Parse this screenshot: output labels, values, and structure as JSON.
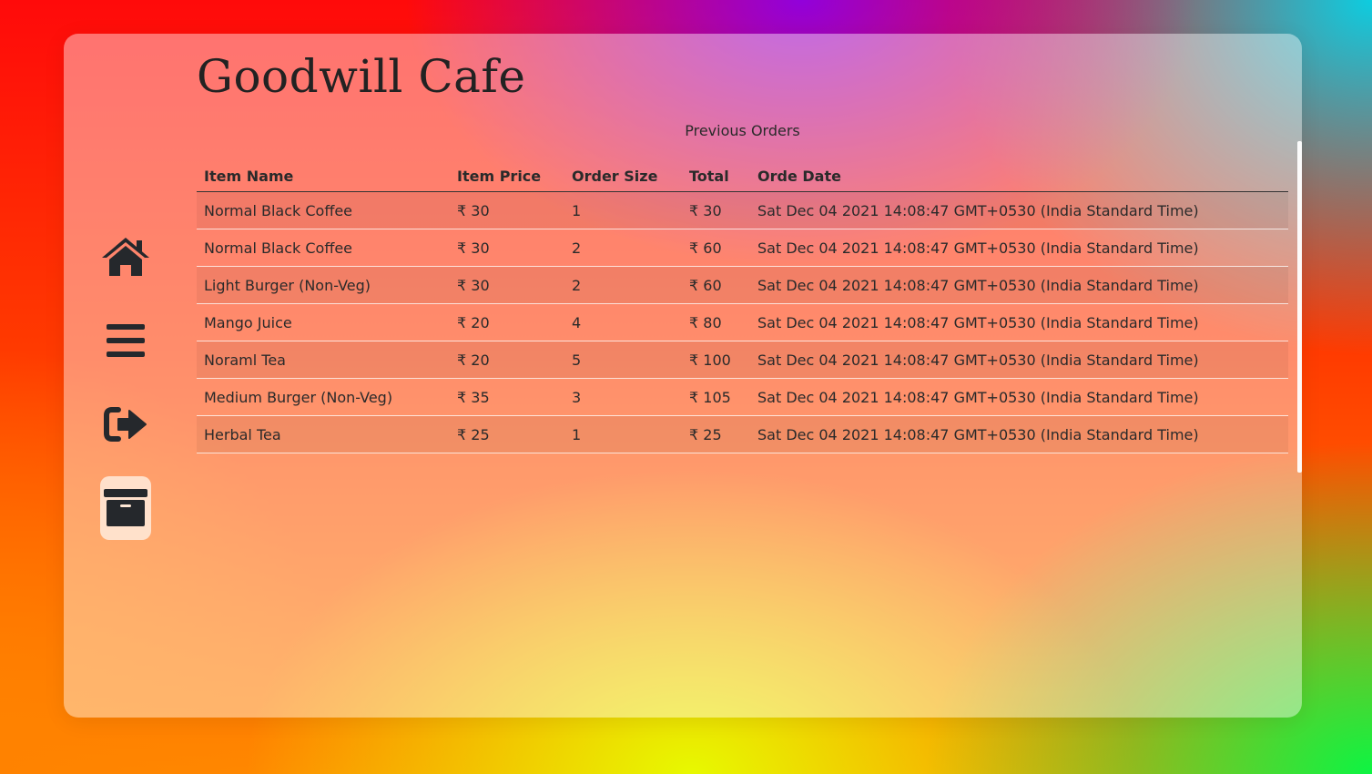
{
  "app": {
    "title": "Goodwill Cafe"
  },
  "sidebar": {
    "items": [
      {
        "name": "home",
        "icon": "home-icon",
        "active": false
      },
      {
        "name": "menu",
        "icon": "hamburger-menu-icon",
        "active": false
      },
      {
        "name": "logout",
        "icon": "sign-out-icon",
        "active": false
      },
      {
        "name": "orders",
        "icon": "archive-box-icon",
        "active": true
      }
    ]
  },
  "orders": {
    "caption": "Previous Orders",
    "headers": [
      "Item Name",
      "Item Price",
      "Order Size",
      "Total",
      "Orde Date"
    ],
    "rows": [
      [
        "Normal Black Coffee",
        "₹ 30",
        "1",
        "₹ 30",
        "Sat Dec 04 2021 14:08:47 GMT+0530 (India Standard Time)"
      ],
      [
        "Normal Black Coffee",
        "₹ 30",
        "2",
        "₹ 60",
        "Sat Dec 04 2021 14:08:47 GMT+0530 (India Standard Time)"
      ],
      [
        "Light Burger (Non-Veg)",
        "₹ 30",
        "2",
        "₹ 60",
        "Sat Dec 04 2021 14:08:47 GMT+0530 (India Standard Time)"
      ],
      [
        "Mango Juice",
        "₹ 20",
        "4",
        "₹ 80",
        "Sat Dec 04 2021 14:08:47 GMT+0530 (India Standard Time)"
      ],
      [
        "Noraml Tea",
        "₹ 20",
        "5",
        "₹ 100",
        "Sat Dec 04 2021 14:08:47 GMT+0530 (India Standard Time)"
      ],
      [
        "Medium Burger (Non-Veg)",
        "₹ 35",
        "3",
        "₹ 105",
        "Sat Dec 04 2021 14:08:47 GMT+0530 (India Standard Time)"
      ],
      [
        "Herbal Tea",
        "₹ 25",
        "1",
        "₹ 25",
        "Sat Dec 04 2021 14:08:47 GMT+0530 (India Standard Time)"
      ]
    ]
  },
  "colors": {
    "icon": "#25282c",
    "active_bg": "#ffe8d6",
    "text": "#2a2a2a"
  }
}
